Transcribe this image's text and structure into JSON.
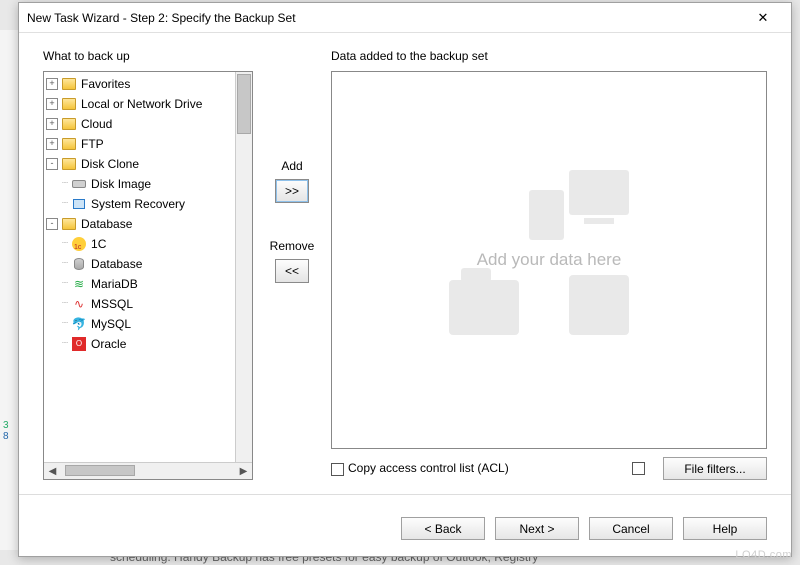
{
  "window": {
    "title": "New Task Wizard - Step 2: Specify the Backup Set",
    "close_glyph": "✕"
  },
  "left": {
    "label": "What to back up",
    "items": [
      {
        "indent": 0,
        "toggle": "+",
        "icon": "folder",
        "label": "Favorites"
      },
      {
        "indent": 0,
        "toggle": "+",
        "icon": "folder",
        "label": "Local or Network Drive"
      },
      {
        "indent": 0,
        "toggle": "+",
        "icon": "folder",
        "label": "Cloud"
      },
      {
        "indent": 0,
        "toggle": "+",
        "icon": "folder",
        "label": "FTP"
      },
      {
        "indent": 0,
        "toggle": "-",
        "icon": "folder",
        "label": "Disk Clone"
      },
      {
        "indent": 1,
        "toggle": "",
        "icon": "disk",
        "label": "Disk Image"
      },
      {
        "indent": 1,
        "toggle": "",
        "icon": "monitor",
        "label": "System Recovery"
      },
      {
        "indent": 0,
        "toggle": "-",
        "icon": "folder",
        "label": "Database"
      },
      {
        "indent": 1,
        "toggle": "",
        "icon": "onec",
        "label": "1C"
      },
      {
        "indent": 1,
        "toggle": "",
        "icon": "db",
        "label": "Database"
      },
      {
        "indent": 1,
        "toggle": "",
        "icon": "maria",
        "label": "MariaDB"
      },
      {
        "indent": 1,
        "toggle": "",
        "icon": "mssql",
        "label": "MSSQL"
      },
      {
        "indent": 1,
        "toggle": "",
        "icon": "mysql",
        "label": "MySQL"
      },
      {
        "indent": 1,
        "toggle": "",
        "icon": "oracle",
        "label": "Oracle"
      }
    ]
  },
  "mid": {
    "add_label": "Add",
    "add_glyph": ">>",
    "remove_label": "Remove",
    "remove_glyph": "<<"
  },
  "right": {
    "label": "Data added to the backup set",
    "placeholder": "Add your data here"
  },
  "options": {
    "acl_label": "Copy access control list (ACL)",
    "filters_label": "File filters..."
  },
  "footer": {
    "back": "< Back",
    "next": "Next >",
    "cancel": "Cancel",
    "help": "Help"
  },
  "watermark": "LO4D.com",
  "bg_text": "scheduling. Handy Backup has free presets for easy backup of Outlook, Registry"
}
